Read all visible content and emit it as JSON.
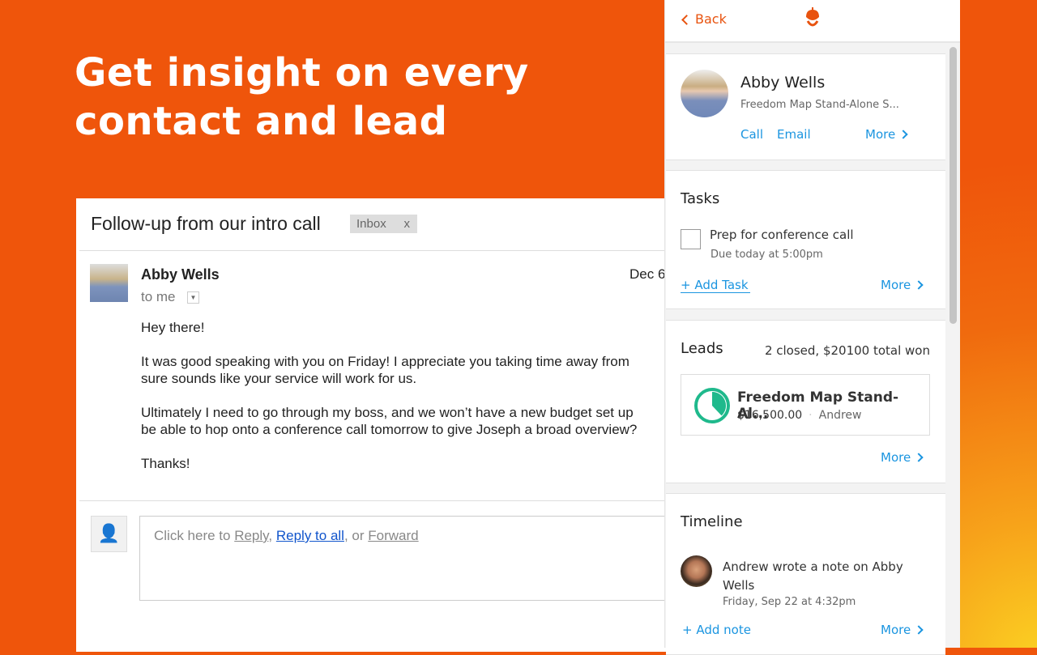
{
  "hero": {
    "line1": "Get insight on every",
    "line2": "contact and lead"
  },
  "email": {
    "subject": "Follow-up from our intro call",
    "label": "Inbox",
    "label_close": "x",
    "sender": "Abby Wells",
    "recipient": "to me",
    "date": "Dec 6",
    "body": [
      "Hey there!",
      "It was good speaking with you on Friday! I appreciate you taking time away from",
      "sure sounds like your service will work for us.",
      "Ultimately I need to go through my boss, and we won’t have a new budget set up",
      "be able to hop onto a conference call tomorrow to give Joseph a broad overview?",
      "Thanks!"
    ],
    "reply": {
      "prefix": "Click here to ",
      "reply": "Reply",
      "sep1": ", ",
      "reply_all": "Reply to all",
      "sep2": ", or ",
      "forward": "Forward"
    }
  },
  "panel": {
    "back": "Back",
    "accent": "#e8530f",
    "link_color": "#1b95e0",
    "contact": {
      "name": "Abby Wells",
      "company": "Freedom Map Stand-Alone S...",
      "call": "Call",
      "email": "Email",
      "more": "More"
    },
    "tasks": {
      "title": "Tasks",
      "items": [
        {
          "title": "Prep for conference call",
          "due": "Due today at 5:00pm",
          "done": false
        }
      ],
      "add": "+ Add Task",
      "more": "More"
    },
    "leads": {
      "title": "Leads",
      "summary": "2 closed, $20100 total won",
      "items": [
        {
          "name": "Freedom Map Stand-Al...",
          "amount": "$16,500.00",
          "owner": "Andrew",
          "progress": 0.38
        }
      ],
      "more": "More"
    },
    "timeline": {
      "title": "Timeline",
      "items": [
        {
          "text": "Andrew wrote a note on Abby Wells",
          "time": "Friday, Sep 22 at 4:32pm"
        }
      ],
      "add": "+ Add note",
      "more": "More"
    }
  }
}
